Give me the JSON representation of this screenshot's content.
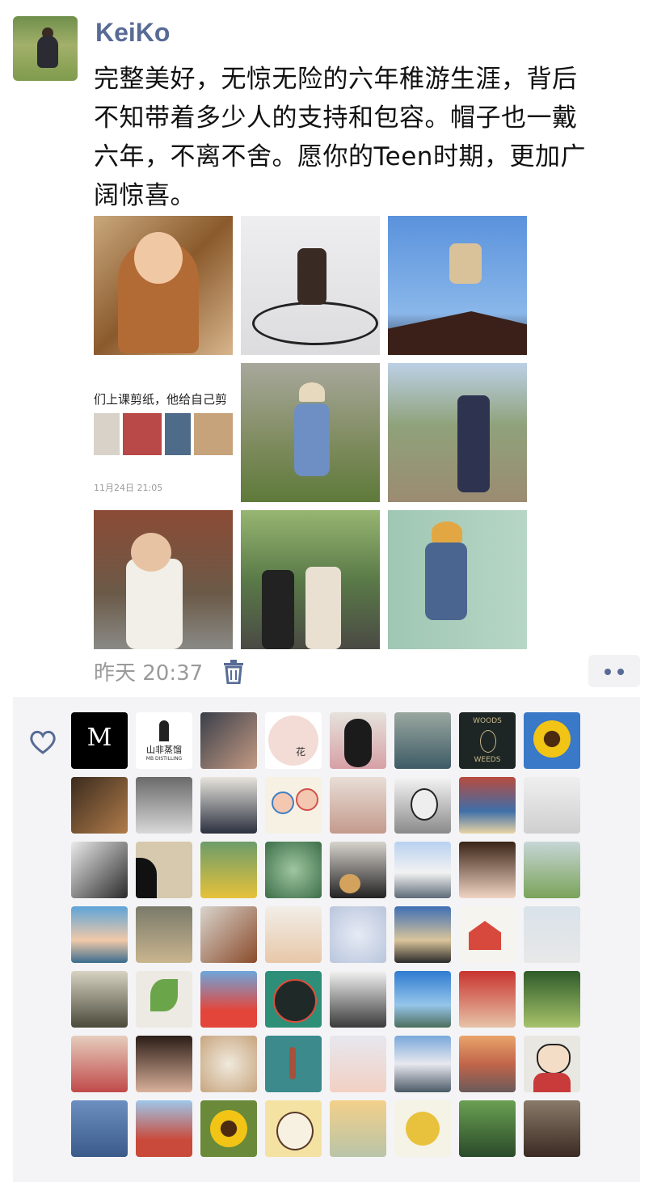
{
  "post": {
    "author": "KeiKo",
    "text": "完整美好，无惊无险的六年稚游生涯，背后\n不知带着多少人的支持和包容。帽子也一戴\n六年，不离不舍。愿你的Teen时期，更加广\n阔惊喜。",
    "embedded_screenshot": {
      "caption": "们上课剪纸，他给自己剪",
      "date": "11月24日 21:05"
    },
    "timestamp": "昨天 20:37"
  },
  "likers": {
    "logos": {
      "m_text": "M",
      "shanfei": "山非蒸馏",
      "shanfei_sub": "MB DISTILLING",
      "woods_top": "WOODS",
      "woods_bottom": "WEEDS",
      "flower": "花"
    }
  },
  "colors": {
    "link_blue": "#576b95",
    "likes_bg": "#f4f4f6",
    "timestamp_grey": "#9a9a9a"
  }
}
